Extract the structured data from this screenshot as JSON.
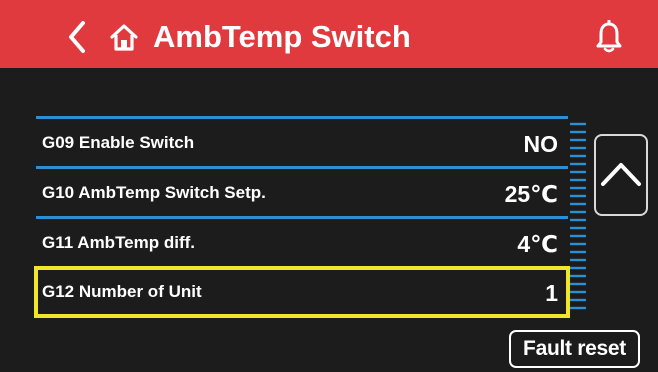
{
  "header": {
    "title": "AmbTemp Switch",
    "background_color": "#e03a3f",
    "icons": [
      "chevron-left-icon",
      "home-icon",
      "bell-icon"
    ]
  },
  "params": [
    {
      "label": "G09 Enable Switch",
      "value": "NO"
    },
    {
      "label": "G10 AmbTemp Switch Setp.",
      "value": "25℃"
    },
    {
      "label": "G11 AmbTemp diff.",
      "value": "4℃"
    },
    {
      "label": "G12 Number of Unit",
      "value": "1",
      "selected": true
    }
  ],
  "colors": {
    "divider": "#2b8fd1",
    "selection_outline": "#f2e62a",
    "background": "#1c1c1c"
  },
  "scroll_up_icon": "chevron-up-icon",
  "fault_reset_label": "Fault reset"
}
